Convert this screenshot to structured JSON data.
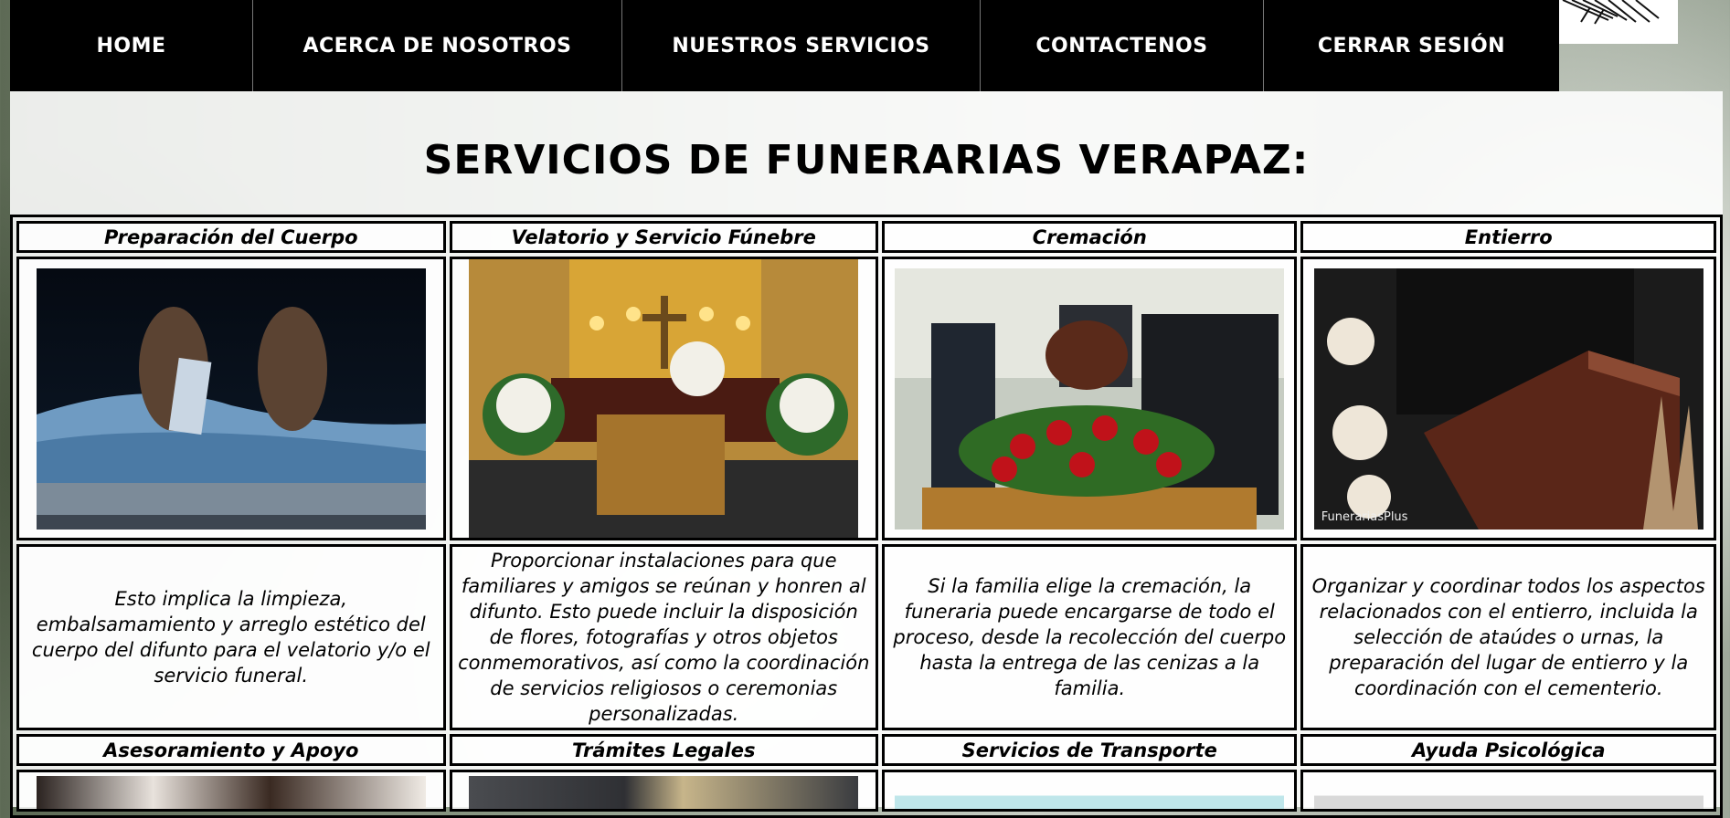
{
  "nav": {
    "items": [
      {
        "label": "HOME"
      },
      {
        "label": "ACERCA DE NOSOTROS"
      },
      {
        "label": "NUESTROS SERVICIOS"
      },
      {
        "label": "CONTACTENOS"
      },
      {
        "label": "CERRAR SESIÓN"
      }
    ]
  },
  "page": {
    "title": "SERVICIOS DE FUNERARIAS VERAPAZ:"
  },
  "services": [
    {
      "name": "Preparación del Cuerpo",
      "description": "Esto implica la limpieza, embalsamamiento y arreglo estético del cuerpo del difunto para el velatorio y/o el servicio funeral."
    },
    {
      "name": "Velatorio y Servicio Fúnebre",
      "description": "Proporcionar instalaciones para que familiares y amigos se reúnan y honren al difunto. Esto puede incluir la disposición de flores, fotografías y otros objetos conmemorativos, así como la coordinación de servicios religiosos o ceremonias personalizadas."
    },
    {
      "name": "Cremación",
      "description": "Si la familia elige la cremación, la funeraria puede encargarse de todo el proceso, desde la recolección del cuerpo hasta la entrega de las cenizas a la familia."
    },
    {
      "name": "Entierro",
      "description": "Organizar y coordinar todos los aspectos relacionados con el entierro, incluida la selección de ataúdes o urnas, la preparación del lugar de entierro y la coordinación con el cementerio.",
      "watermark": "FunerariasPlus"
    }
  ],
  "services_row2": [
    {
      "name": "Asesoramiento y Apoyo"
    },
    {
      "name": "Trámites Legales"
    },
    {
      "name": "Servicios de Transporte"
    },
    {
      "name": "Ayuda Psicológica"
    }
  ],
  "colors": {
    "nav_bg": "#000000",
    "nav_text": "#ffffff",
    "content_bg": "#ffffff"
  }
}
